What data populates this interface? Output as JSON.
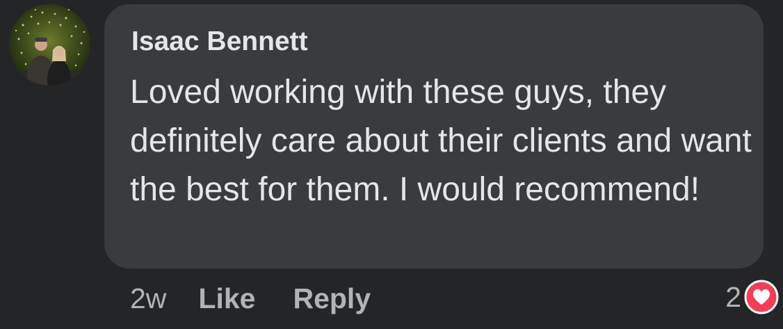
{
  "comment": {
    "author": "Isaac Bennett",
    "text": "Loved working with these guys, they definitely care about their clients and want the best for them. I would recommend!",
    "timestamp": "2w",
    "actions": {
      "like": "Like",
      "reply": "Reply"
    },
    "reactions": {
      "count": "2",
      "type": "heart-icon",
      "color": "#f33e58"
    }
  }
}
